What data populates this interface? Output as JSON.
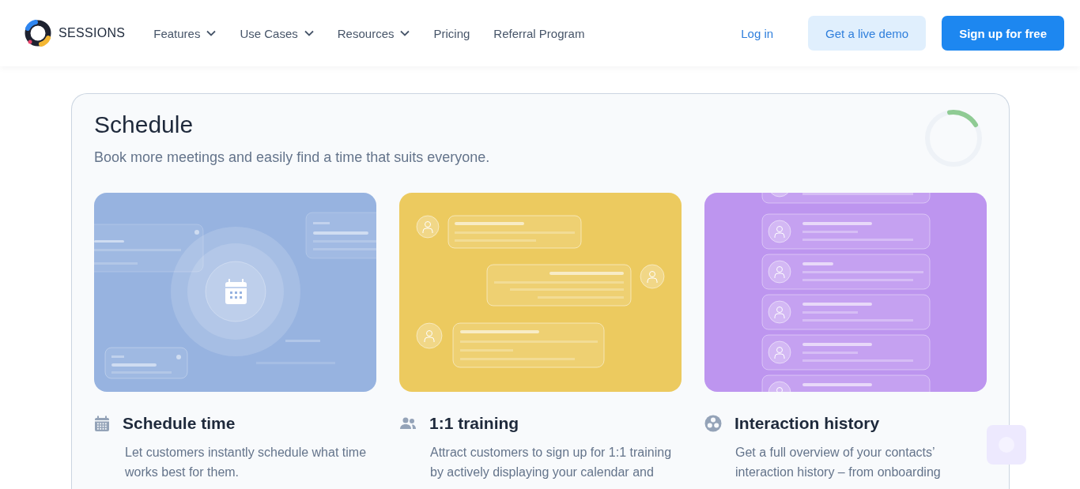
{
  "header": {
    "brand": "SESSIONS",
    "nav": [
      {
        "label": "Features",
        "dropdown": true
      },
      {
        "label": "Use Cases",
        "dropdown": true
      },
      {
        "label": "Resources",
        "dropdown": true
      },
      {
        "label": "Pricing",
        "dropdown": false
      },
      {
        "label": "Referral Program",
        "dropdown": false
      }
    ],
    "login": "Log in",
    "demo": "Get a live demo",
    "signup": "Sign up for free"
  },
  "section": {
    "title": "Schedule",
    "subtitle": "Book more meetings and easily find a time that suits everyone.",
    "features": [
      {
        "kind": "schedule",
        "title": "Schedule time",
        "description": "Let customers instantly schedule what time works best for them."
      },
      {
        "kind": "training",
        "title": "1:1 training",
        "description": "Attract customers to sign up for 1:1 training by actively displaying your calendar and"
      },
      {
        "kind": "history",
        "title": "Interaction history",
        "description": "Get a full overview of your contacts’ interaction history – from onboarding"
      }
    ]
  }
}
